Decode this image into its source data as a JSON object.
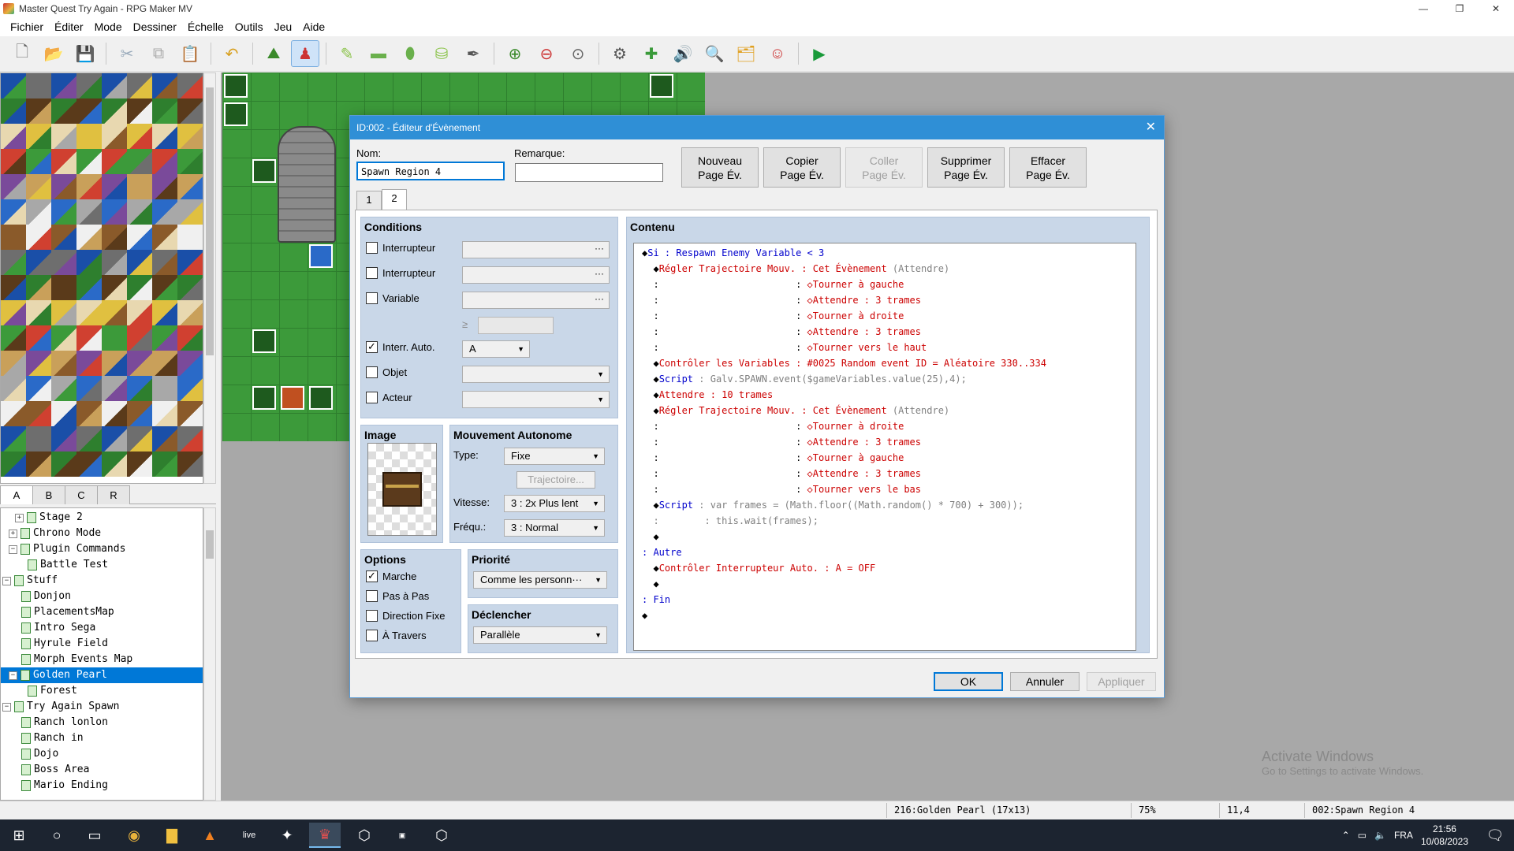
{
  "window": {
    "title": "Master Quest Try Again - RPG Maker MV",
    "controls": [
      "—",
      "❐",
      "✕"
    ]
  },
  "menu": [
    "Fichier",
    "Éditer",
    "Mode",
    "Dessiner",
    "Échelle",
    "Outils",
    "Jeu",
    "Aide"
  ],
  "toolbar": {
    "icons": [
      "new-project-icon",
      "open-project-icon",
      "save-project-icon",
      "cut-icon",
      "copy-icon",
      "paste-icon",
      "undo-icon",
      "map-mode-icon",
      "event-mode-icon",
      "pencil-icon",
      "rectangle-icon",
      "ellipse-icon",
      "fill-icon",
      "shadow-pen-icon",
      "zoom-in-icon",
      "zoom-out-icon",
      "actual-size-icon",
      "database-icon",
      "plugin-manager-icon",
      "sound-test-icon",
      "event-searcher-icon",
      "resource-manager-icon",
      "character-generator-icon",
      "playtest-icon"
    ]
  },
  "tileset": {
    "tabs": [
      "A",
      "B",
      "C",
      "R"
    ],
    "selected_tab": "A"
  },
  "maptree": {
    "items": [
      {
        "label": "Stage 2",
        "indent": 1,
        "expander": "+"
      },
      {
        "label": "Chrono Mode",
        "indent": 0,
        "expander": "+"
      },
      {
        "label": "Plugin Commands",
        "indent": 0,
        "expander": "−"
      },
      {
        "label": "Battle Test",
        "indent": 1,
        "expander": ""
      },
      {
        "label": "Stuff",
        "indent": -1,
        "expander": "−"
      },
      {
        "label": "Donjon",
        "indent": 0,
        "expander": ""
      },
      {
        "label": "PlacementsMap",
        "indent": 0,
        "expander": ""
      },
      {
        "label": "Intro Sega",
        "indent": 0,
        "expander": ""
      },
      {
        "label": "Hyrule Field",
        "indent": 0,
        "expander": ""
      },
      {
        "label": "Morph Events Map",
        "indent": 0,
        "expander": ""
      },
      {
        "label": "Golden Pearl",
        "indent": 0,
        "expander": "−",
        "selected": true
      },
      {
        "label": "Forest",
        "indent": 1,
        "expander": ""
      },
      {
        "label": "Try Again Spawn",
        "indent": -1,
        "expander": "−"
      },
      {
        "label": "Ranch lonlon",
        "indent": 0,
        "expander": ""
      },
      {
        "label": "Ranch in",
        "indent": 0,
        "expander": ""
      },
      {
        "label": "Dojo",
        "indent": 0,
        "expander": ""
      },
      {
        "label": "Boss Area",
        "indent": 0,
        "expander": ""
      },
      {
        "label": "Mario Ending",
        "indent": 0,
        "expander": ""
      }
    ]
  },
  "watermark": {
    "line1": "Activate Windows",
    "line2": "Go to Settings to activate Windows."
  },
  "statusbar": {
    "map": "216:Golden Pearl (17x13)",
    "zoom": "75%",
    "coords": "11,4",
    "event": "002:Spawn Region 4"
  },
  "taskbar": {
    "icons": [
      "start-icon",
      "search-icon",
      "task-view-icon",
      "chrome-icon",
      "file-explorer-icon",
      "vlc-icon",
      "live-app-icon",
      "controller-app-icon",
      "rpg-maker-icon",
      "unity-icon",
      "obs-icon",
      "unity-hub-icon"
    ],
    "lang": "FRA",
    "time": "21:56",
    "date": "10/08/2023"
  },
  "dialog": {
    "title": "ID:002 - Éditeur d'Évènement",
    "name_label": "Nom:",
    "name_value": "Spawn Region 4",
    "note_label": "Remarque:",
    "note_value": "",
    "page_buttons": [
      {
        "line1": "Nouveau",
        "line2": "Page Év.",
        "disabled": false
      },
      {
        "line1": "Copier",
        "line2": "Page Év.",
        "disabled": false
      },
      {
        "line1": "Coller",
        "line2": "Page Év.",
        "disabled": true
      },
      {
        "line1": "Supprimer",
        "line2": "Page Év.",
        "disabled": false
      },
      {
        "line1": "Effacer",
        "line2": "Page Év.",
        "disabled": false
      }
    ],
    "page_tabs": [
      "1",
      "2"
    ],
    "selected_page": "2",
    "conditions": {
      "title": "Conditions",
      "switch1_label": "Interrupteur",
      "switch2_label": "Interrupteur",
      "variable_label": "Variable",
      "gte_symbol": "≥",
      "self_switch_label": "Interr. Auto.",
      "self_switch_checked": true,
      "self_switch_value": "A",
      "item_label": "Objet",
      "actor_label": "Acteur",
      "dots": "···"
    },
    "image": {
      "title": "Image"
    },
    "movement": {
      "title": "Mouvement Autonome",
      "type_label": "Type:",
      "type_value": "Fixe",
      "route_button": "Trajectoire...",
      "speed_label": "Vitesse:",
      "speed_value": "3 : 2x Plus lent",
      "freq_label": "Fréqu.:",
      "freq_value": "3 : Normal"
    },
    "options": {
      "title": "Options",
      "walking_label": "Marche",
      "walking_checked": true,
      "stepping_label": "Pas à Pas",
      "direction_fix_label": "Direction Fixe",
      "through_label": "À Travers"
    },
    "priority": {
      "title": "Priorité",
      "value": "Comme les personn···"
    },
    "trigger": {
      "title": "Déclencher",
      "value": "Parallèle"
    },
    "contents": {
      "title": "Contenu",
      "lines": [
        [
          {
            "t": "◆",
            "c": "c-black"
          },
          {
            "t": "Si",
            "c": "c-blue"
          },
          {
            "t": " : Respawn Enemy Variable < 3",
            "c": "c-blue"
          }
        ],
        [
          {
            "t": "  ◆",
            "c": "c-black"
          },
          {
            "t": "Régler Trajectoire Mouv.",
            "c": "c-red"
          },
          {
            "t": " : Cet Évènement ",
            "c": "c-red"
          },
          {
            "t": "(Attendre)",
            "c": "c-gray"
          }
        ],
        [
          {
            "t": "  :                        : ",
            "c": "c-black"
          },
          {
            "t": "◇Tourner à gauche",
            "c": "c-red"
          }
        ],
        [
          {
            "t": "  :                        : ",
            "c": "c-black"
          },
          {
            "t": "◇Attendre : 3 trames",
            "c": "c-red"
          }
        ],
        [
          {
            "t": "  :                        : ",
            "c": "c-black"
          },
          {
            "t": "◇Tourner à droite",
            "c": "c-red"
          }
        ],
        [
          {
            "t": "  :                        : ",
            "c": "c-black"
          },
          {
            "t": "◇Attendre : 3 trames",
            "c": "c-red"
          }
        ],
        [
          {
            "t": "  :                        : ",
            "c": "c-black"
          },
          {
            "t": "◇Tourner vers le haut",
            "c": "c-red"
          }
        ],
        [
          {
            "t": "  ◆",
            "c": "c-black"
          },
          {
            "t": "Contrôler les Variables : #0025 Random event ID = Aléatoire 330..334",
            "c": "c-red"
          }
        ],
        [
          {
            "t": "  ◆",
            "c": "c-black"
          },
          {
            "t": "Script",
            "c": "c-blue"
          },
          {
            "t": " : Galv.SPAWN.event($gameVariables.value(25),4);",
            "c": "c-gray"
          }
        ],
        [
          {
            "t": "  ◆",
            "c": "c-black"
          },
          {
            "t": "Attendre : 10 trames",
            "c": "c-red"
          }
        ],
        [
          {
            "t": "  ◆",
            "c": "c-black"
          },
          {
            "t": "Régler Trajectoire Mouv.",
            "c": "c-red"
          },
          {
            "t": " : Cet Évènement ",
            "c": "c-red"
          },
          {
            "t": "(Attendre)",
            "c": "c-gray"
          }
        ],
        [
          {
            "t": "  :                        : ",
            "c": "c-black"
          },
          {
            "t": "◇Tourner à droite",
            "c": "c-red"
          }
        ],
        [
          {
            "t": "  :                        : ",
            "c": "c-black"
          },
          {
            "t": "◇Attendre : 3 trames",
            "c": "c-red"
          }
        ],
        [
          {
            "t": "  :                        : ",
            "c": "c-black"
          },
          {
            "t": "◇Tourner à gauche",
            "c": "c-red"
          }
        ],
        [
          {
            "t": "  :                        : ",
            "c": "c-black"
          },
          {
            "t": "◇Attendre : 3 trames",
            "c": "c-red"
          }
        ],
        [
          {
            "t": "  :                        : ",
            "c": "c-black"
          },
          {
            "t": "◇Tourner vers le bas",
            "c": "c-red"
          }
        ],
        [
          {
            "t": "  ◆",
            "c": "c-black"
          },
          {
            "t": "Script",
            "c": "c-blue"
          },
          {
            "t": " : var frames = (Math.floor((Math.random() * 700) + 300));",
            "c": "c-gray"
          }
        ],
        [
          {
            "t": "  :        : this.wait(frames);",
            "c": "c-gray"
          }
        ],
        [
          {
            "t": "  ◆",
            "c": "c-black"
          }
        ],
        [
          {
            "t": ": Autre",
            "c": "c-blue"
          }
        ],
        [
          {
            "t": "  ◆",
            "c": "c-black"
          },
          {
            "t": "Contrôler Interrupteur Auto. : A = OFF",
            "c": "c-red"
          }
        ],
        [
          {
            "t": "  ◆",
            "c": "c-black"
          }
        ],
        [
          {
            "t": ": Fin",
            "c": "c-blue"
          }
        ],
        [
          {
            "t": "◆",
            "c": "c-black"
          }
        ]
      ]
    },
    "buttons": {
      "ok": "OK",
      "cancel": "Annuler",
      "apply": "Appliquer"
    }
  },
  "colors": {
    "accent": "#0078d7",
    "dialog_title": "#2f8fd6",
    "group_bg": "#c9d7e8",
    "grass": "#3c9a3a"
  }
}
